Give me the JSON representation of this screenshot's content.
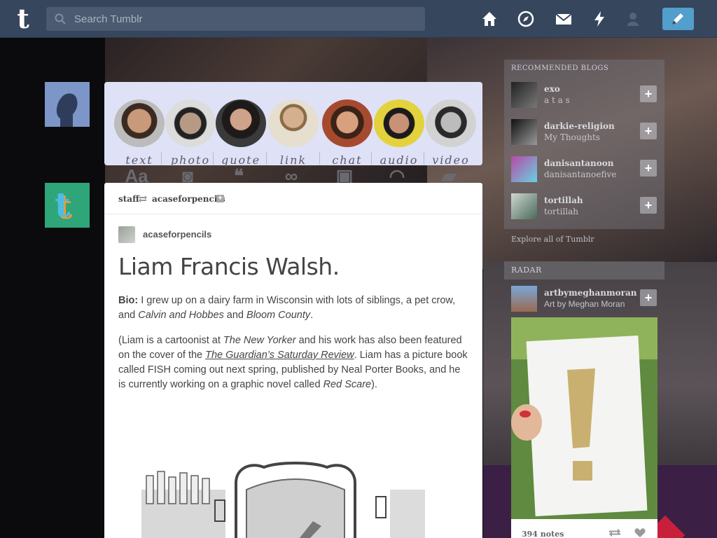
{
  "header": {
    "logo": "t",
    "search_placeholder": "Search Tumblr",
    "nav": [
      "home-icon",
      "compass-icon",
      "mail-icon",
      "lightning-icon",
      "account-icon"
    ],
    "compose": "pencil-icon"
  },
  "chooser": {
    "items": [
      {
        "label": "text"
      },
      {
        "label": "photo"
      },
      {
        "label": "quote"
      },
      {
        "label": "link"
      },
      {
        "label": "chat"
      },
      {
        "label": "audio"
      },
      {
        "label": "video"
      }
    ]
  },
  "post": {
    "reblogger": "staff",
    "source_blog": "acaseforpencils",
    "follow_glyph": "+",
    "author": "acaseforpencils",
    "title": "Liam Francis Walsh.",
    "bio_label": "Bio:",
    "bio_text_1": "I grew up on a dairy farm in Wisconsin with lots of siblings, a pet crow, and",
    "bio_em_1": "Calvin and Hobbes",
    "bio_and": "and",
    "bio_em_2": "Bloom County",
    "bio_end": ".",
    "p2_1": "(Liam is a cartoonist at",
    "p2_em_1": "The New Yorker",
    "p2_2": "and his work has also been featured on the cover of the",
    "p2_link": "The Guardian’s Saturday Review",
    "p2_3": ". Liam has a picture book called FISH coming out next spring, published by Neal Porter Books, and he is currently working on a graphic novel called",
    "p2_em_2": "Red Scare",
    "p2_4": ")."
  },
  "sidebar": {
    "recommended_title": "Recommended Blogs",
    "recommended": [
      {
        "name": "exo",
        "sub": "a t a s"
      },
      {
        "name": "darkie-religion",
        "sub": "My Thoughts"
      },
      {
        "name": "danisantanoon",
        "sub": "danisantanoefive"
      },
      {
        "name": "tortillah",
        "sub": "tortillah"
      }
    ],
    "explore": "Explore all of Tumblr",
    "radar_title": "Radar",
    "radar": {
      "name": "artbymeghanmoran",
      "sub": "Art by Meghan Moran",
      "notes": "394 notes"
    }
  },
  "colors": {
    "header": "#36465d",
    "compose": "#529ecc",
    "card": "#ffffff"
  }
}
